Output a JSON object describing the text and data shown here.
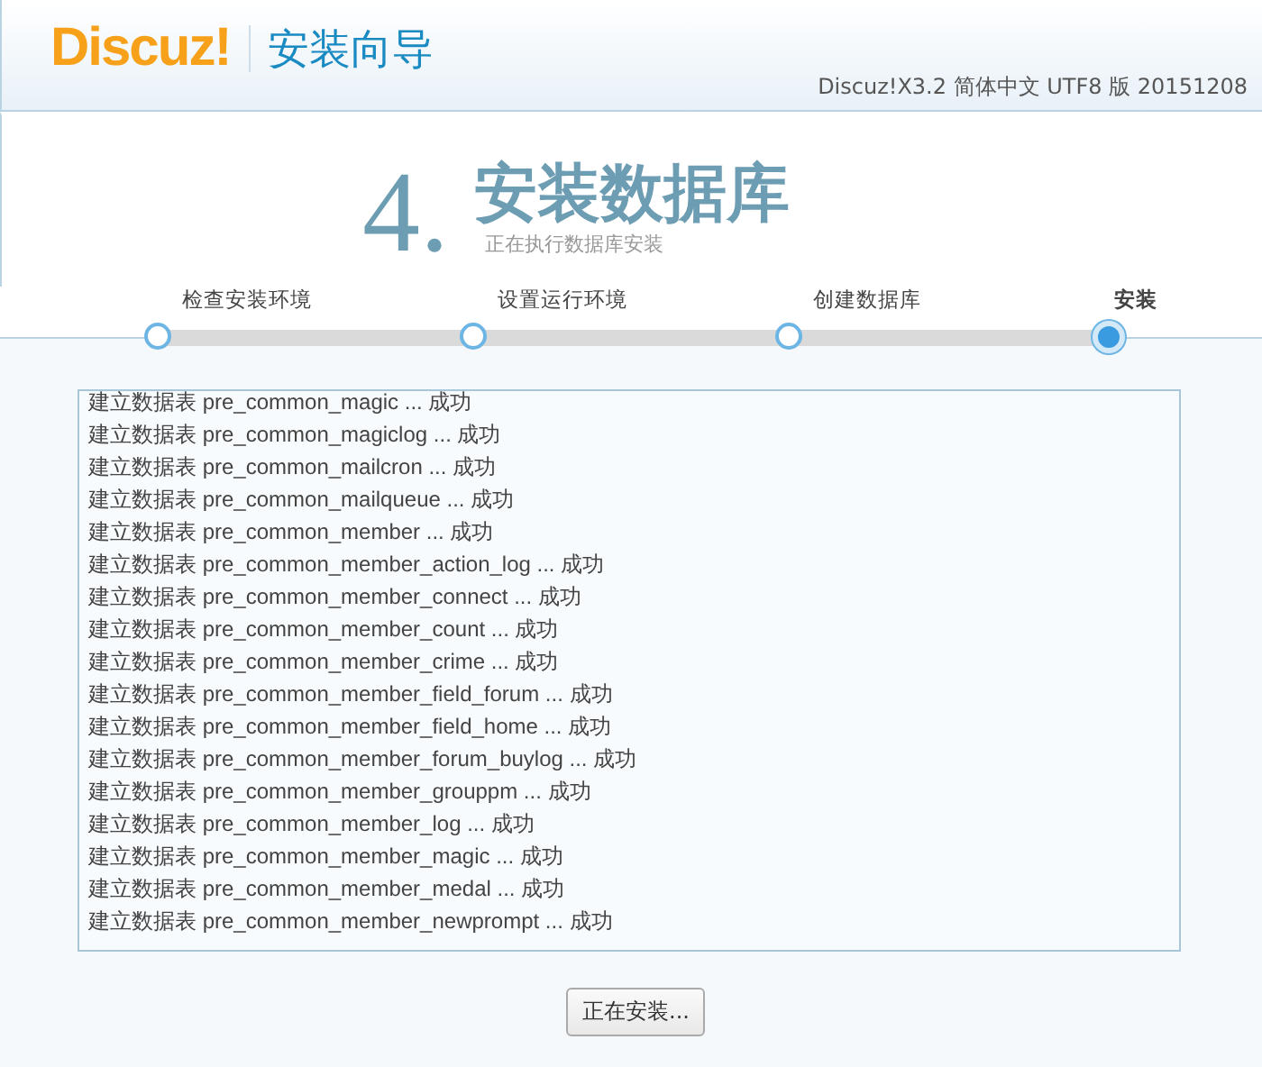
{
  "header": {
    "logo": "Discuz!",
    "title": "安装向导",
    "version": "Discuz!X3.2 简体中文 UTF8 版 20151208"
  },
  "heading": {
    "number": "4.",
    "title": "安装数据库",
    "subtitle": "正在执行数据库安装"
  },
  "steps": [
    {
      "label": "检查安装环境",
      "selected": false
    },
    {
      "label": "设置运行环境",
      "selected": false
    },
    {
      "label": "创建数据库",
      "selected": false
    },
    {
      "label": "安装",
      "selected": true
    }
  ],
  "log": [
    "建立数据表 pre_common_magic ... 成功",
    "建立数据表 pre_common_magiclog ... 成功",
    "建立数据表 pre_common_mailcron ... 成功",
    "建立数据表 pre_common_mailqueue ... 成功",
    "建立数据表 pre_common_member ... 成功",
    "建立数据表 pre_common_member_action_log ... 成功",
    "建立数据表 pre_common_member_connect ... 成功",
    "建立数据表 pre_common_member_count ... 成功",
    "建立数据表 pre_common_member_crime ... 成功",
    "建立数据表 pre_common_member_field_forum ... 成功",
    "建立数据表 pre_common_member_field_home ... 成功",
    "建立数据表 pre_common_member_forum_buylog ... 成功",
    "建立数据表 pre_common_member_grouppm ... 成功",
    "建立数据表 pre_common_member_log ... 成功",
    "建立数据表 pre_common_member_magic ... 成功",
    "建立数据表 pre_common_member_medal ... 成功",
    "建立数据表 pre_common_member_newprompt ... 成功"
  ],
  "button": {
    "label": "正在安装...",
    "disabled": true
  }
}
